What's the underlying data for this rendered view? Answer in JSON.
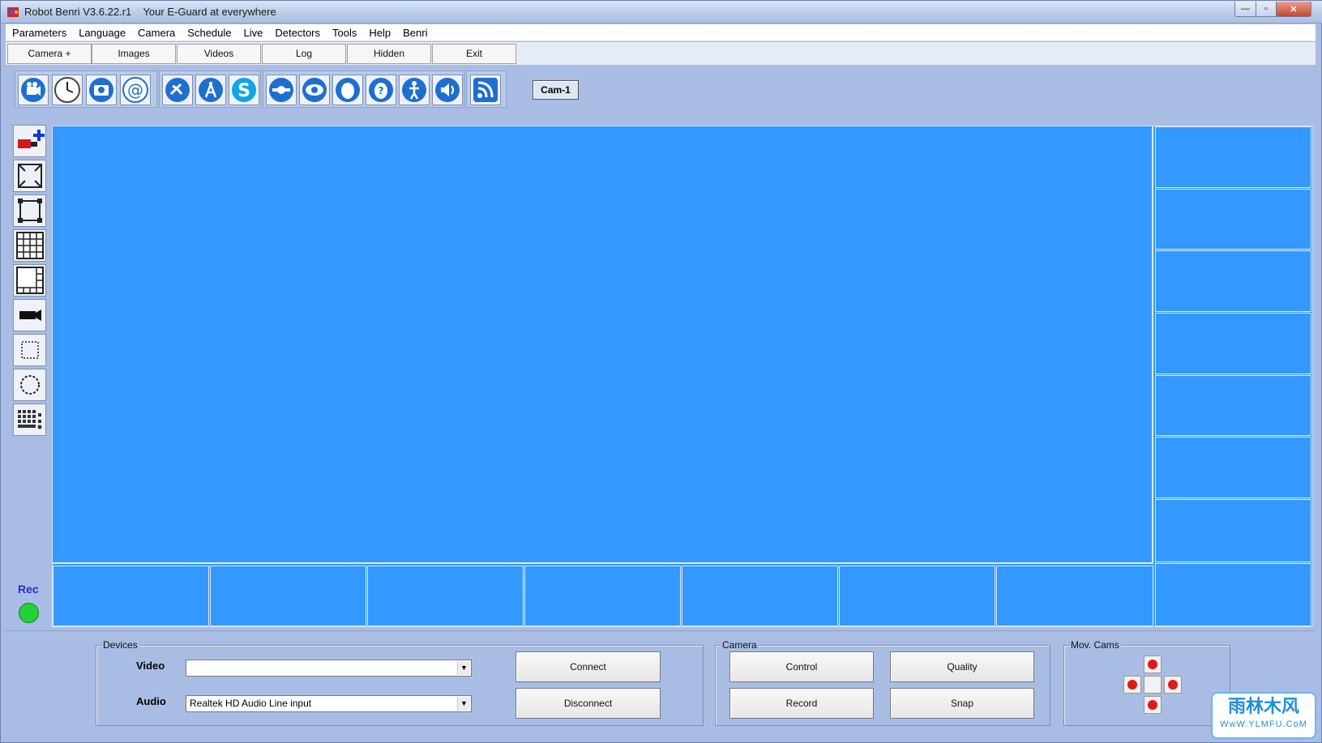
{
  "window": {
    "title": "Robot Benri V3.6.22.r1    Your E-Guard at everywhere",
    "minimize": "—",
    "maximize": "▫",
    "close": "✕"
  },
  "menu": [
    "Parameters",
    "Language",
    "Camera",
    "Schedule",
    "Live",
    "Detectors",
    "Tools",
    "Help",
    "Benri"
  ],
  "tabs": [
    "Camera +",
    "Images",
    "Videos",
    "Log",
    "Hidden",
    "Exit"
  ],
  "toolbar": {
    "icons": [
      "webcam-icon",
      "clock-icon",
      "camera-icon",
      "email-at-icon",
      "satellite-dish-icon",
      "antenna-icon",
      "skype-icon",
      "pan-tilt-icon",
      "eye-icon",
      "face-icon",
      "face-help-icon",
      "person-icon",
      "speaker-icon",
      "rss-feed-icon"
    ],
    "camera_label": "Cam-1"
  },
  "left_toolbar": {
    "icons": [
      "add-camera-icon",
      "fullscreen-icon",
      "fit-window-icon",
      "grid-view-icon",
      "layout-view-icon",
      "video-camera-icon",
      "selection-icon",
      "rotate-icon",
      "keypad-icon"
    ],
    "rec_label": "Rec",
    "rec_status_color": "#22d23a"
  },
  "devices": {
    "legend": "Devices",
    "video_label": "Video",
    "video_value": "",
    "audio_label": "Audio",
    "audio_value": "Realtek HD Audio Line input",
    "connect": "Connect",
    "disconnect": "Disconnect"
  },
  "camera_panel": {
    "legend": "Camera",
    "control": "Control",
    "quality": "Quality",
    "record": "Record",
    "snap": "Snap"
  },
  "mov_cams": {
    "legend": "Mov. Cams"
  },
  "watermark": {
    "main": "雨林木风",
    "sub": "WwW.YLMFU.CoM"
  },
  "colors": {
    "video_bg": "#3399ff",
    "panel_bg": "#a9bde4"
  }
}
